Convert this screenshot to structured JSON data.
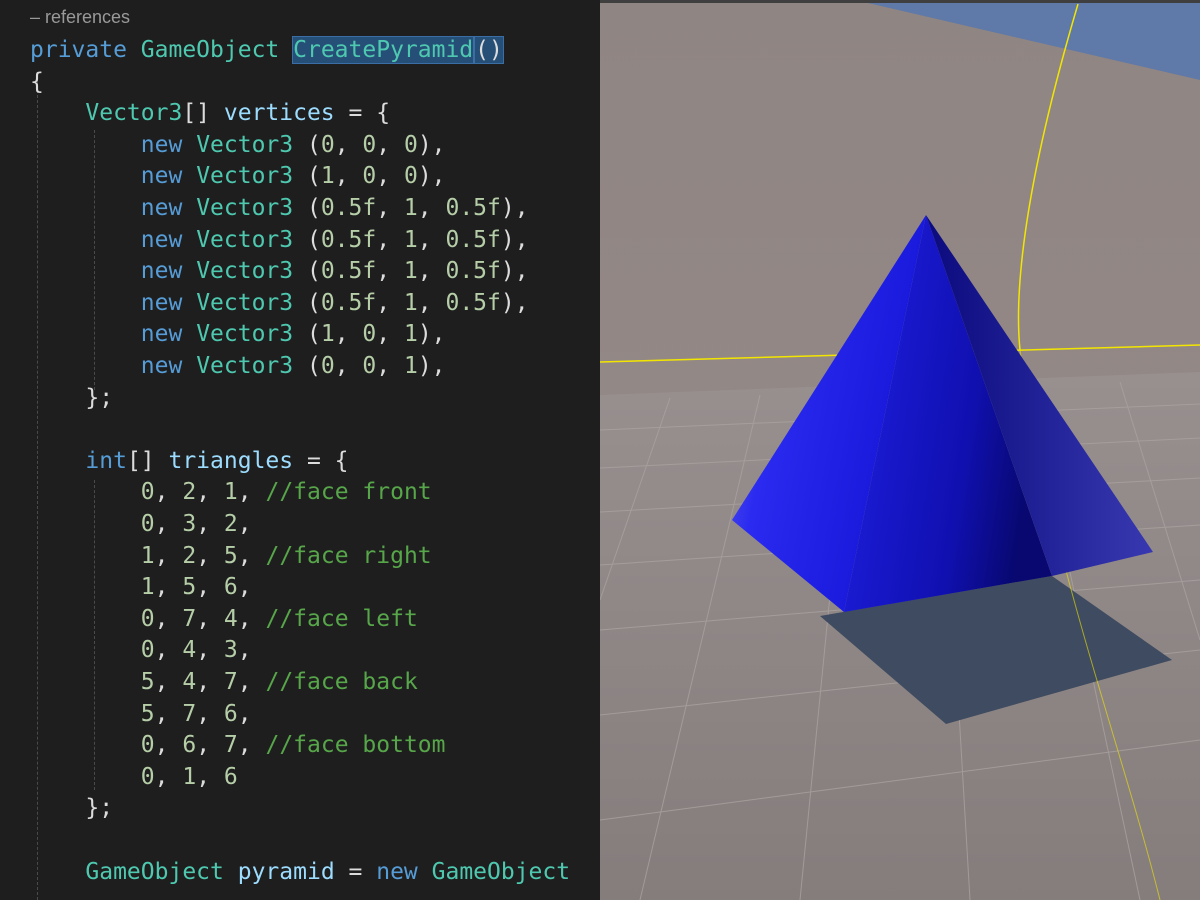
{
  "editor": {
    "codelens": "– references",
    "lines": [
      {
        "segments": [
          {
            "t": "private",
            "c": "kw"
          },
          {
            "t": " ",
            "c": "pn"
          },
          {
            "t": "GameObject",
            "c": "ty"
          },
          {
            "t": " ",
            "c": "pn"
          },
          {
            "t": "CreatePyramid",
            "c": "ty sel"
          },
          {
            "t": "caret",
            "c": "caret"
          },
          {
            "t": "()",
            "c": "pn sel"
          }
        ]
      },
      {
        "segments": [
          {
            "t": "{",
            "c": "pn"
          }
        ]
      },
      {
        "segments": [
          {
            "t": "    ",
            "c": "pn"
          },
          {
            "t": "Vector3",
            "c": "ty"
          },
          {
            "t": "[] ",
            "c": "pn"
          },
          {
            "t": "vertices",
            "c": "id"
          },
          {
            "t": " = {",
            "c": "pn"
          }
        ]
      },
      {
        "segments": [
          {
            "t": "        ",
            "c": "pn"
          },
          {
            "t": "new",
            "c": "kw"
          },
          {
            "t": " ",
            "c": "pn"
          },
          {
            "t": "Vector3",
            "c": "ty"
          },
          {
            "t": " (",
            "c": "pn"
          },
          {
            "t": "0",
            "c": "num"
          },
          {
            "t": ", ",
            "c": "pn"
          },
          {
            "t": "0",
            "c": "num"
          },
          {
            "t": ", ",
            "c": "pn"
          },
          {
            "t": "0",
            "c": "num"
          },
          {
            "t": "),",
            "c": "pn"
          }
        ]
      },
      {
        "segments": [
          {
            "t": "        ",
            "c": "pn"
          },
          {
            "t": "new",
            "c": "kw"
          },
          {
            "t": " ",
            "c": "pn"
          },
          {
            "t": "Vector3",
            "c": "ty"
          },
          {
            "t": " (",
            "c": "pn"
          },
          {
            "t": "1",
            "c": "num"
          },
          {
            "t": ", ",
            "c": "pn"
          },
          {
            "t": "0",
            "c": "num"
          },
          {
            "t": ", ",
            "c": "pn"
          },
          {
            "t": "0",
            "c": "num"
          },
          {
            "t": "),",
            "c": "pn"
          }
        ]
      },
      {
        "segments": [
          {
            "t": "        ",
            "c": "pn"
          },
          {
            "t": "new",
            "c": "kw"
          },
          {
            "t": " ",
            "c": "pn"
          },
          {
            "t": "Vector3",
            "c": "ty"
          },
          {
            "t": " (",
            "c": "pn"
          },
          {
            "t": "0.5f",
            "c": "num"
          },
          {
            "t": ", ",
            "c": "pn"
          },
          {
            "t": "1",
            "c": "num"
          },
          {
            "t": ", ",
            "c": "pn"
          },
          {
            "t": "0.5f",
            "c": "num"
          },
          {
            "t": "),",
            "c": "pn"
          }
        ]
      },
      {
        "segments": [
          {
            "t": "        ",
            "c": "pn"
          },
          {
            "t": "new",
            "c": "kw"
          },
          {
            "t": " ",
            "c": "pn"
          },
          {
            "t": "Vector3",
            "c": "ty"
          },
          {
            "t": " (",
            "c": "pn"
          },
          {
            "t": "0.5f",
            "c": "num"
          },
          {
            "t": ", ",
            "c": "pn"
          },
          {
            "t": "1",
            "c": "num"
          },
          {
            "t": ", ",
            "c": "pn"
          },
          {
            "t": "0.5f",
            "c": "num"
          },
          {
            "t": "),",
            "c": "pn"
          }
        ]
      },
      {
        "segments": [
          {
            "t": "        ",
            "c": "pn"
          },
          {
            "t": "new",
            "c": "kw"
          },
          {
            "t": " ",
            "c": "pn"
          },
          {
            "t": "Vector3",
            "c": "ty"
          },
          {
            "t": " (",
            "c": "pn"
          },
          {
            "t": "0.5f",
            "c": "num"
          },
          {
            "t": ", ",
            "c": "pn"
          },
          {
            "t": "1",
            "c": "num"
          },
          {
            "t": ", ",
            "c": "pn"
          },
          {
            "t": "0.5f",
            "c": "num"
          },
          {
            "t": "),",
            "c": "pn"
          }
        ]
      },
      {
        "segments": [
          {
            "t": "        ",
            "c": "pn"
          },
          {
            "t": "new",
            "c": "kw"
          },
          {
            "t": " ",
            "c": "pn"
          },
          {
            "t": "Vector3",
            "c": "ty"
          },
          {
            "t": " (",
            "c": "pn"
          },
          {
            "t": "0.5f",
            "c": "num"
          },
          {
            "t": ", ",
            "c": "pn"
          },
          {
            "t": "1",
            "c": "num"
          },
          {
            "t": ", ",
            "c": "pn"
          },
          {
            "t": "0.5f",
            "c": "num"
          },
          {
            "t": "),",
            "c": "pn"
          }
        ]
      },
      {
        "segments": [
          {
            "t": "        ",
            "c": "pn"
          },
          {
            "t": "new",
            "c": "kw"
          },
          {
            "t": " ",
            "c": "pn"
          },
          {
            "t": "Vector3",
            "c": "ty"
          },
          {
            "t": " (",
            "c": "pn"
          },
          {
            "t": "1",
            "c": "num"
          },
          {
            "t": ", ",
            "c": "pn"
          },
          {
            "t": "0",
            "c": "num"
          },
          {
            "t": ", ",
            "c": "pn"
          },
          {
            "t": "1",
            "c": "num"
          },
          {
            "t": "),",
            "c": "pn"
          }
        ]
      },
      {
        "segments": [
          {
            "t": "        ",
            "c": "pn"
          },
          {
            "t": "new",
            "c": "kw"
          },
          {
            "t": " ",
            "c": "pn"
          },
          {
            "t": "Vector3",
            "c": "ty"
          },
          {
            "t": " (",
            "c": "pn"
          },
          {
            "t": "0",
            "c": "num"
          },
          {
            "t": ", ",
            "c": "pn"
          },
          {
            "t": "0",
            "c": "num"
          },
          {
            "t": ", ",
            "c": "pn"
          },
          {
            "t": "1",
            "c": "num"
          },
          {
            "t": "),",
            "c": "pn"
          }
        ]
      },
      {
        "segments": [
          {
            "t": "    };",
            "c": "pn"
          }
        ]
      },
      {
        "segments": []
      },
      {
        "segments": [
          {
            "t": "    ",
            "c": "pn"
          },
          {
            "t": "int",
            "c": "kw"
          },
          {
            "t": "[] ",
            "c": "pn"
          },
          {
            "t": "triangles",
            "c": "id"
          },
          {
            "t": " = {",
            "c": "pn"
          }
        ]
      },
      {
        "segments": [
          {
            "t": "        ",
            "c": "pn"
          },
          {
            "t": "0",
            "c": "num"
          },
          {
            "t": ", ",
            "c": "pn"
          },
          {
            "t": "2",
            "c": "num"
          },
          {
            "t": ", ",
            "c": "pn"
          },
          {
            "t": "1",
            "c": "num"
          },
          {
            "t": ", ",
            "c": "pn"
          },
          {
            "t": "//face front",
            "c": "cmt"
          }
        ]
      },
      {
        "segments": [
          {
            "t": "        ",
            "c": "pn"
          },
          {
            "t": "0",
            "c": "num"
          },
          {
            "t": ", ",
            "c": "pn"
          },
          {
            "t": "3",
            "c": "num"
          },
          {
            "t": ", ",
            "c": "pn"
          },
          {
            "t": "2",
            "c": "num"
          },
          {
            "t": ",",
            "c": "pn"
          }
        ]
      },
      {
        "segments": [
          {
            "t": "        ",
            "c": "pn"
          },
          {
            "t": "1",
            "c": "num"
          },
          {
            "t": ", ",
            "c": "pn"
          },
          {
            "t": "2",
            "c": "num"
          },
          {
            "t": ", ",
            "c": "pn"
          },
          {
            "t": "5",
            "c": "num"
          },
          {
            "t": ", ",
            "c": "pn"
          },
          {
            "t": "//face right",
            "c": "cmt"
          }
        ]
      },
      {
        "segments": [
          {
            "t": "        ",
            "c": "pn"
          },
          {
            "t": "1",
            "c": "num"
          },
          {
            "t": ", ",
            "c": "pn"
          },
          {
            "t": "5",
            "c": "num"
          },
          {
            "t": ", ",
            "c": "pn"
          },
          {
            "t": "6",
            "c": "num"
          },
          {
            "t": ",",
            "c": "pn"
          }
        ]
      },
      {
        "segments": [
          {
            "t": "        ",
            "c": "pn"
          },
          {
            "t": "0",
            "c": "num"
          },
          {
            "t": ", ",
            "c": "pn"
          },
          {
            "t": "7",
            "c": "num"
          },
          {
            "t": ", ",
            "c": "pn"
          },
          {
            "t": "4",
            "c": "num"
          },
          {
            "t": ", ",
            "c": "pn"
          },
          {
            "t": "//face left",
            "c": "cmt"
          }
        ]
      },
      {
        "segments": [
          {
            "t": "        ",
            "c": "pn"
          },
          {
            "t": "0",
            "c": "num"
          },
          {
            "t": ", ",
            "c": "pn"
          },
          {
            "t": "4",
            "c": "num"
          },
          {
            "t": ", ",
            "c": "pn"
          },
          {
            "t": "3",
            "c": "num"
          },
          {
            "t": ",",
            "c": "pn"
          }
        ]
      },
      {
        "segments": [
          {
            "t": "        ",
            "c": "pn"
          },
          {
            "t": "5",
            "c": "num"
          },
          {
            "t": ", ",
            "c": "pn"
          },
          {
            "t": "4",
            "c": "num"
          },
          {
            "t": ", ",
            "c": "pn"
          },
          {
            "t": "7",
            "c": "num"
          },
          {
            "t": ", ",
            "c": "pn"
          },
          {
            "t": "//face back",
            "c": "cmt"
          }
        ]
      },
      {
        "segments": [
          {
            "t": "        ",
            "c": "pn"
          },
          {
            "t": "5",
            "c": "num"
          },
          {
            "t": ", ",
            "c": "pn"
          },
          {
            "t": "7",
            "c": "num"
          },
          {
            "t": ", ",
            "c": "pn"
          },
          {
            "t": "6",
            "c": "num"
          },
          {
            "t": ",",
            "c": "pn"
          }
        ]
      },
      {
        "segments": [
          {
            "t": "        ",
            "c": "pn"
          },
          {
            "t": "0",
            "c": "num"
          },
          {
            "t": ", ",
            "c": "pn"
          },
          {
            "t": "6",
            "c": "num"
          },
          {
            "t": ", ",
            "c": "pn"
          },
          {
            "t": "7",
            "c": "num"
          },
          {
            "t": ", ",
            "c": "pn"
          },
          {
            "t": "//face bottom",
            "c": "cmt"
          }
        ]
      },
      {
        "segments": [
          {
            "t": "        ",
            "c": "pn"
          },
          {
            "t": "0",
            "c": "num"
          },
          {
            "t": ", ",
            "c": "pn"
          },
          {
            "t": "1",
            "c": "num"
          },
          {
            "t": ", ",
            "c": "pn"
          },
          {
            "t": "6",
            "c": "num"
          }
        ]
      },
      {
        "segments": [
          {
            "t": "    };",
            "c": "pn"
          }
        ]
      },
      {
        "segments": []
      },
      {
        "segments": [
          {
            "t": "    ",
            "c": "pn"
          },
          {
            "t": "GameObject",
            "c": "ty"
          },
          {
            "t": " ",
            "c": "pn"
          },
          {
            "t": "pyramid",
            "c": "id"
          },
          {
            "t": " = ",
            "c": "pn"
          },
          {
            "t": "new",
            "c": "kw"
          },
          {
            "t": " ",
            "c": "pn"
          },
          {
            "t": "GameObject",
            "c": "ty"
          }
        ]
      }
    ]
  },
  "scene": {
    "object": "pyramid",
    "object_color": "#1e1ee0",
    "ground_color": "#8c8584",
    "sky_color": "#8f8584",
    "gizmo_color": "#ffee00"
  }
}
